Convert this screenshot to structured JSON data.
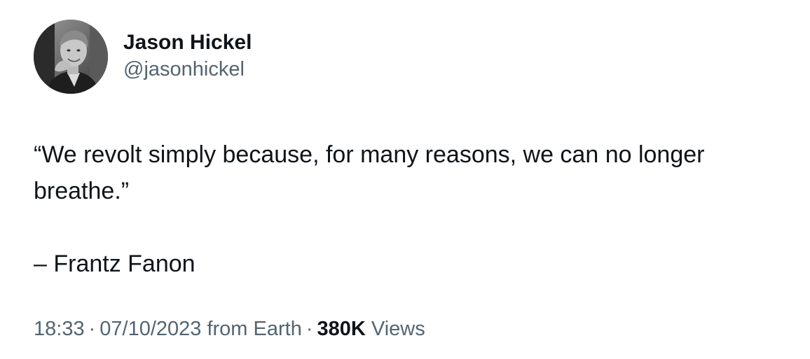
{
  "author": {
    "display_name": "Jason Hickel",
    "handle": "@jasonhickel",
    "avatar_icon": "profile-photo-avatar"
  },
  "tweet": {
    "quote_line": "“We revolt simply because, for many reasons, we can no longer breathe.”",
    "attribution": "– Frantz Fanon"
  },
  "meta": {
    "time": "18:33",
    "separator": "·",
    "date": "07/10/2023",
    "source": "from Earth",
    "views_count": "380K",
    "views_label": "Views"
  },
  "colors": {
    "text_primary": "#0f1419",
    "text_secondary": "#536471",
    "background": "#ffffff"
  }
}
